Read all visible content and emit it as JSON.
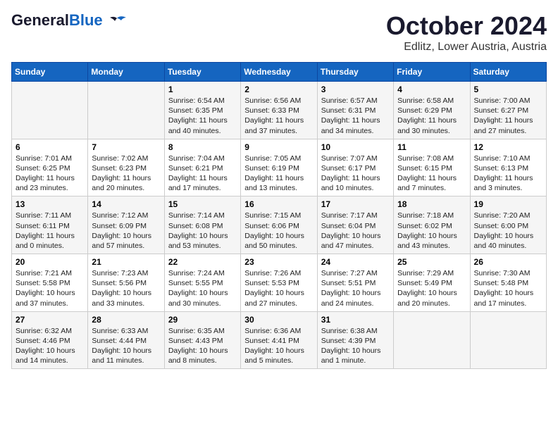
{
  "header": {
    "logo_general": "General",
    "logo_blue": "Blue",
    "title": "October 2024",
    "subtitle": "Edlitz, Lower Austria, Austria"
  },
  "weekdays": [
    "Sunday",
    "Monday",
    "Tuesday",
    "Wednesday",
    "Thursday",
    "Friday",
    "Saturday"
  ],
  "weeks": [
    [
      {
        "day": "",
        "sunrise": "",
        "sunset": "",
        "daylight": ""
      },
      {
        "day": "",
        "sunrise": "",
        "sunset": "",
        "daylight": ""
      },
      {
        "day": "1",
        "sunrise": "Sunrise: 6:54 AM",
        "sunset": "Sunset: 6:35 PM",
        "daylight": "Daylight: 11 hours and 40 minutes."
      },
      {
        "day": "2",
        "sunrise": "Sunrise: 6:56 AM",
        "sunset": "Sunset: 6:33 PM",
        "daylight": "Daylight: 11 hours and 37 minutes."
      },
      {
        "day": "3",
        "sunrise": "Sunrise: 6:57 AM",
        "sunset": "Sunset: 6:31 PM",
        "daylight": "Daylight: 11 hours and 34 minutes."
      },
      {
        "day": "4",
        "sunrise": "Sunrise: 6:58 AM",
        "sunset": "Sunset: 6:29 PM",
        "daylight": "Daylight: 11 hours and 30 minutes."
      },
      {
        "day": "5",
        "sunrise": "Sunrise: 7:00 AM",
        "sunset": "Sunset: 6:27 PM",
        "daylight": "Daylight: 11 hours and 27 minutes."
      }
    ],
    [
      {
        "day": "6",
        "sunrise": "Sunrise: 7:01 AM",
        "sunset": "Sunset: 6:25 PM",
        "daylight": "Daylight: 11 hours and 23 minutes."
      },
      {
        "day": "7",
        "sunrise": "Sunrise: 7:02 AM",
        "sunset": "Sunset: 6:23 PM",
        "daylight": "Daylight: 11 hours and 20 minutes."
      },
      {
        "day": "8",
        "sunrise": "Sunrise: 7:04 AM",
        "sunset": "Sunset: 6:21 PM",
        "daylight": "Daylight: 11 hours and 17 minutes."
      },
      {
        "day": "9",
        "sunrise": "Sunrise: 7:05 AM",
        "sunset": "Sunset: 6:19 PM",
        "daylight": "Daylight: 11 hours and 13 minutes."
      },
      {
        "day": "10",
        "sunrise": "Sunrise: 7:07 AM",
        "sunset": "Sunset: 6:17 PM",
        "daylight": "Daylight: 11 hours and 10 minutes."
      },
      {
        "day": "11",
        "sunrise": "Sunrise: 7:08 AM",
        "sunset": "Sunset: 6:15 PM",
        "daylight": "Daylight: 11 hours and 7 minutes."
      },
      {
        "day": "12",
        "sunrise": "Sunrise: 7:10 AM",
        "sunset": "Sunset: 6:13 PM",
        "daylight": "Daylight: 11 hours and 3 minutes."
      }
    ],
    [
      {
        "day": "13",
        "sunrise": "Sunrise: 7:11 AM",
        "sunset": "Sunset: 6:11 PM",
        "daylight": "Daylight: 11 hours and 0 minutes."
      },
      {
        "day": "14",
        "sunrise": "Sunrise: 7:12 AM",
        "sunset": "Sunset: 6:09 PM",
        "daylight": "Daylight: 10 hours and 57 minutes."
      },
      {
        "day": "15",
        "sunrise": "Sunrise: 7:14 AM",
        "sunset": "Sunset: 6:08 PM",
        "daylight": "Daylight: 10 hours and 53 minutes."
      },
      {
        "day": "16",
        "sunrise": "Sunrise: 7:15 AM",
        "sunset": "Sunset: 6:06 PM",
        "daylight": "Daylight: 10 hours and 50 minutes."
      },
      {
        "day": "17",
        "sunrise": "Sunrise: 7:17 AM",
        "sunset": "Sunset: 6:04 PM",
        "daylight": "Daylight: 10 hours and 47 minutes."
      },
      {
        "day": "18",
        "sunrise": "Sunrise: 7:18 AM",
        "sunset": "Sunset: 6:02 PM",
        "daylight": "Daylight: 10 hours and 43 minutes."
      },
      {
        "day": "19",
        "sunrise": "Sunrise: 7:20 AM",
        "sunset": "Sunset: 6:00 PM",
        "daylight": "Daylight: 10 hours and 40 minutes."
      }
    ],
    [
      {
        "day": "20",
        "sunrise": "Sunrise: 7:21 AM",
        "sunset": "Sunset: 5:58 PM",
        "daylight": "Daylight: 10 hours and 37 minutes."
      },
      {
        "day": "21",
        "sunrise": "Sunrise: 7:23 AM",
        "sunset": "Sunset: 5:56 PM",
        "daylight": "Daylight: 10 hours and 33 minutes."
      },
      {
        "day": "22",
        "sunrise": "Sunrise: 7:24 AM",
        "sunset": "Sunset: 5:55 PM",
        "daylight": "Daylight: 10 hours and 30 minutes."
      },
      {
        "day": "23",
        "sunrise": "Sunrise: 7:26 AM",
        "sunset": "Sunset: 5:53 PM",
        "daylight": "Daylight: 10 hours and 27 minutes."
      },
      {
        "day": "24",
        "sunrise": "Sunrise: 7:27 AM",
        "sunset": "Sunset: 5:51 PM",
        "daylight": "Daylight: 10 hours and 24 minutes."
      },
      {
        "day": "25",
        "sunrise": "Sunrise: 7:29 AM",
        "sunset": "Sunset: 5:49 PM",
        "daylight": "Daylight: 10 hours and 20 minutes."
      },
      {
        "day": "26",
        "sunrise": "Sunrise: 7:30 AM",
        "sunset": "Sunset: 5:48 PM",
        "daylight": "Daylight: 10 hours and 17 minutes."
      }
    ],
    [
      {
        "day": "27",
        "sunrise": "Sunrise: 6:32 AM",
        "sunset": "Sunset: 4:46 PM",
        "daylight": "Daylight: 10 hours and 14 minutes."
      },
      {
        "day": "28",
        "sunrise": "Sunrise: 6:33 AM",
        "sunset": "Sunset: 4:44 PM",
        "daylight": "Daylight: 10 hours and 11 minutes."
      },
      {
        "day": "29",
        "sunrise": "Sunrise: 6:35 AM",
        "sunset": "Sunset: 4:43 PM",
        "daylight": "Daylight: 10 hours and 8 minutes."
      },
      {
        "day": "30",
        "sunrise": "Sunrise: 6:36 AM",
        "sunset": "Sunset: 4:41 PM",
        "daylight": "Daylight: 10 hours and 5 minutes."
      },
      {
        "day": "31",
        "sunrise": "Sunrise: 6:38 AM",
        "sunset": "Sunset: 4:39 PM",
        "daylight": "Daylight: 10 hours and 1 minute."
      },
      {
        "day": "",
        "sunrise": "",
        "sunset": "",
        "daylight": ""
      },
      {
        "day": "",
        "sunrise": "",
        "sunset": "",
        "daylight": ""
      }
    ]
  ]
}
